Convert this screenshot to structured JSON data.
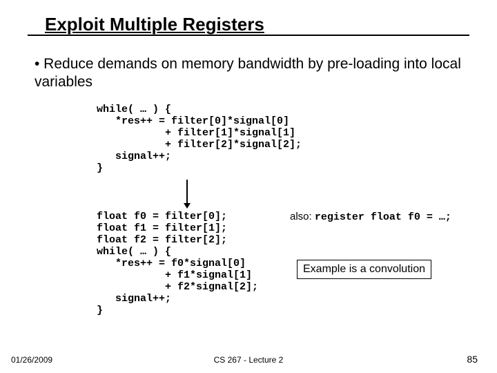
{
  "title": "Exploit Multiple Registers",
  "bullet": "• Reduce demands on memory bandwidth by pre-loading into local variables",
  "code1": "while( … ) {\n   *res++ = filter[0]*signal[0]\n           + filter[1]*signal[1]\n           + filter[2]*signal[2];\n   signal++;\n}",
  "code2": "float f0 = filter[0];\nfloat f1 = filter[1];\nfloat f2 = filter[2];\nwhile( … ) {\n   *res++ = f0*signal[0]\n           + f1*signal[1]\n           + f2*signal[2];\n   signal++;\n}",
  "also_prefix": "also: ",
  "also_code": "register float f0 = …;",
  "example_box": "Example is a convolution",
  "footer": {
    "left": "01/26/2009",
    "center": "CS 267 - Lecture 2",
    "right": "85"
  }
}
